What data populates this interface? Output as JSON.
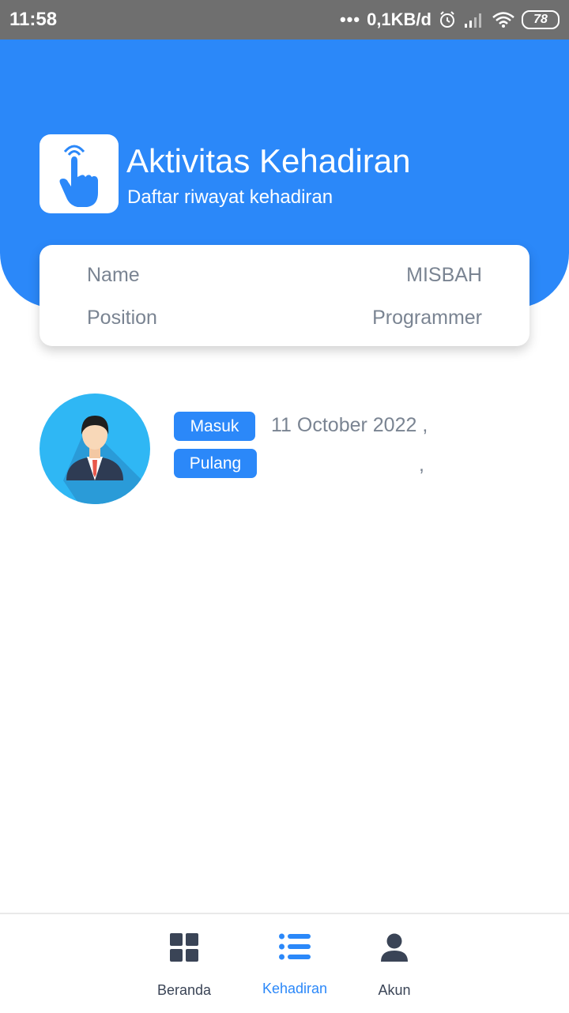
{
  "status_bar": {
    "time": "11:58",
    "network_speed": "0,1KB/d",
    "battery": "78",
    "icons": [
      "dots-icon",
      "alarm-icon",
      "signal-icon",
      "wifi-icon",
      "battery-icon"
    ]
  },
  "header": {
    "title": "Aktivitas Kehadiran",
    "subtitle": "Daftar riwayat kehadiran",
    "logo_icon": "touch-hand-icon"
  },
  "profile": {
    "name_label": "Name",
    "name_value": "MISBAH",
    "position_label": "Position",
    "position_value": "Programmer"
  },
  "attendance": [
    {
      "avatar_icon": "businessman-avatar-icon",
      "in_label": "Masuk",
      "in_text": "11 October 2022 ,",
      "out_label": "Pulang",
      "out_text": ","
    }
  ],
  "bottom_nav": {
    "items": [
      {
        "label": "Beranda",
        "icon": "grid-icon",
        "active": false
      },
      {
        "label": "Kehadiran",
        "icon": "list-icon",
        "active": true
      },
      {
        "label": "Akun",
        "icon": "user-icon",
        "active": false
      }
    ]
  },
  "colors": {
    "primary": "#2b88f9",
    "status_bar": "#6f6f6f",
    "text_muted": "#7a8492",
    "nav_text": "#3a4456"
  }
}
